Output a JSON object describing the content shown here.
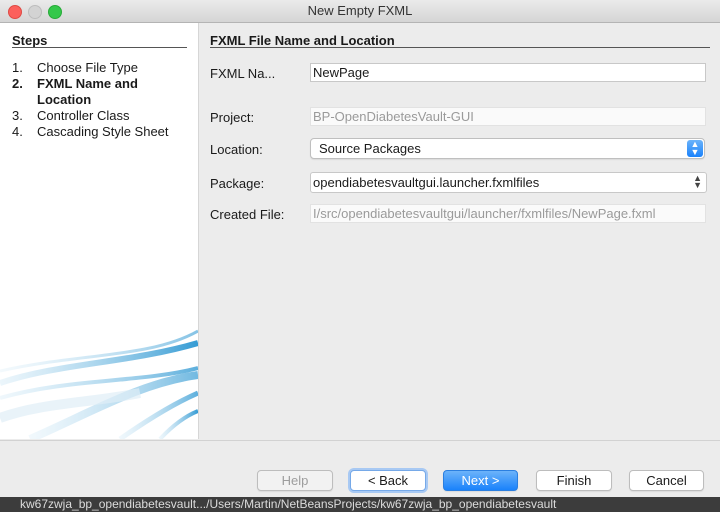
{
  "window": {
    "title": "New Empty FXML"
  },
  "steps": {
    "heading": "Steps",
    "items": [
      {
        "num": "1.",
        "label": "Choose File Type",
        "active": false
      },
      {
        "num": "2.",
        "label": "FXML Name and Location",
        "active": true
      },
      {
        "num": "3.",
        "label": "Controller Class",
        "active": false
      },
      {
        "num": "4.",
        "label": "Cascading Style Sheet",
        "active": false
      }
    ]
  },
  "panel": {
    "heading": "FXML File Name and Location",
    "fxml_name_label": "FXML Na...",
    "fxml_name_value": "NewPage",
    "project_label": "Project:",
    "project_value": "BP-OpenDiabetesVault-GUI",
    "location_label": "Location:",
    "location_value": "Source Packages",
    "package_label": "Package:",
    "package_value": "opendiabetesvaultgui.launcher.fxmlfiles",
    "created_label": "Created File:",
    "created_value": "I/src/opendiabetesvaultgui/launcher/fxmlfiles/NewPage.fxml"
  },
  "buttons": {
    "help": "Help",
    "back": "< Back",
    "next": "Next >",
    "finish": "Finish",
    "cancel": "Cancel"
  },
  "taskbar": {
    "text": "kw67zwja_bp_opendiabetesvault.../Users/Martin/NetBeansProjects/kw67zwja_bp_opendiabetesvault"
  },
  "colors": {
    "accent": "#1a82fb",
    "swirl": "#2f9bd3"
  },
  "icons": [
    "close-window-icon",
    "minimize-window-icon",
    "zoom-window-icon",
    "dropdown-arrow-icon",
    "combo-arrow-icon",
    "swirl-graphic"
  ]
}
